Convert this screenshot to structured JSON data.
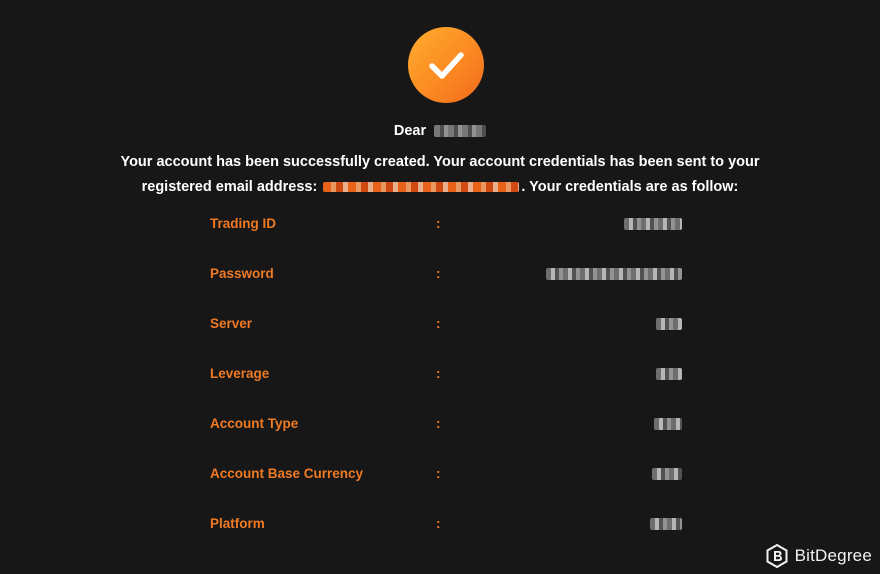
{
  "header": {
    "icon": "check-circle-icon",
    "accent_color": "#f7811f"
  },
  "greeting": {
    "prefix": "Dear",
    "name_redacted": true
  },
  "message": {
    "line_1": "Your account has been successfully created. Your account credentials has been sent to your",
    "line_2_prefix": "registered email address:",
    "email_redacted": true,
    "line_2_suffix": ". Your credentials are as follow:"
  },
  "credentials": {
    "separator": ":",
    "label_color": "#f07a24",
    "rows": [
      {
        "label": "Trading ID",
        "value_redacted": true
      },
      {
        "label": "Password",
        "value_redacted": true
      },
      {
        "label": "Server",
        "value_redacted": true
      },
      {
        "label": "Leverage",
        "value_redacted": true
      },
      {
        "label": "Account Type",
        "value_redacted": true
      },
      {
        "label": "Account Base Currency",
        "value_redacted": true
      },
      {
        "label": "Platform",
        "value_redacted": true
      }
    ]
  },
  "watermark": {
    "text": "BitDegree",
    "icon": "bitdegree-logo-icon"
  }
}
